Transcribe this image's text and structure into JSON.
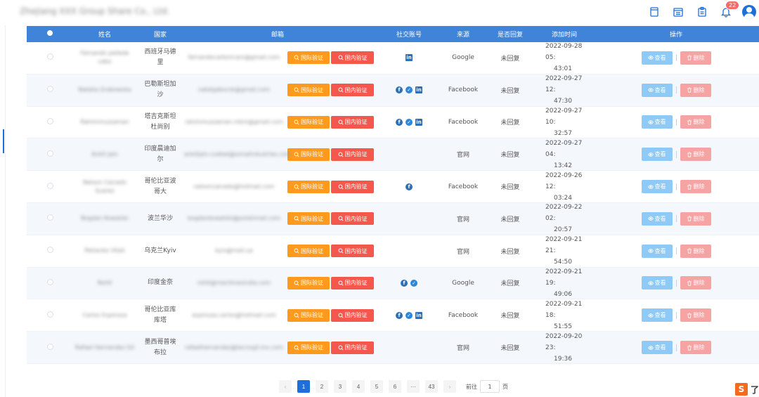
{
  "header": {
    "company": "Zhejiang XXX Group Share Co., Ltd.",
    "notification_count": "22",
    "icons": [
      "tablet-icon",
      "calendar-icon",
      "clipboard-icon",
      "bell-icon",
      "user-avatar"
    ]
  },
  "table": {
    "columns": [
      "姓名",
      "国家",
      "邮箱",
      "社交账号",
      "来源",
      "是否回复",
      "添加时间",
      "操作"
    ],
    "rows": [
      {
        "name": "Fernando paileda cabo",
        "country": "西班牙马德里",
        "email": "fernandocarboncaro@gmail.com",
        "social": [
          "linkedin"
        ],
        "source": "Google",
        "reply": "未回复",
        "time1": "2022-09-28 05:",
        "time2": "43:01"
      },
      {
        "name": "Natalia Grabowska",
        "country": "巴勒斯坦加沙",
        "email": "natalgaborsk@gmail.com",
        "social": [
          "facebook",
          "twitter",
          "linkedin"
        ],
        "source": "Facebook",
        "reply": "未回复",
        "time1": "2022-09-27 12:",
        "time2": "47:30"
      },
      {
        "name": "Rahimmuzzaman",
        "country": "塔吉克斯坦杜尚别",
        "email": "rahimmuzzaman.mkm@gmail.com",
        "social": [
          "facebook",
          "twitter",
          "linkedin"
        ],
        "source": "Facebook",
        "reply": "未回复",
        "time1": "2022-09-27 10:",
        "time2": "32:57"
      },
      {
        "name": "Ankit Jain",
        "country": "印度晨迪加尔",
        "email": "ankitjain.coated@sonalindustries.com",
        "social": [],
        "source": "官网",
        "reply": "未回复",
        "time1": "2022-09-27 04:",
        "time2": "13:42"
      },
      {
        "name": "Nelson Caicedo Suarez",
        "country": "哥伦比亚波哥大",
        "email": "nelsoncaicedo@hotmail.com",
        "social": [
          "facebook"
        ],
        "source": "Facebook",
        "reply": "未回复",
        "time1": "2022-09-26 12:",
        "time2": "03:24"
      },
      {
        "name": "Bogdan Kowalski",
        "country": "波兰华沙",
        "email": "bogdankowalski@polskimail.com",
        "social": [],
        "source": "官网",
        "reply": "未回复",
        "time1": "2022-09-22 02:",
        "time2": "20:57"
      },
      {
        "name": "Petrenko Vitali",
        "country": "乌克兰Kyiv",
        "email": "kyiv@mail.ua",
        "social": [],
        "source": "官网",
        "reply": "未回复",
        "time1": "2022-09-21 21:",
        "time2": "54:50"
      },
      {
        "name": "Rohit",
        "country": "印度金奈",
        "email": "rohit@machinesindia.com",
        "social": [
          "facebook",
          "twitter"
        ],
        "source": "Google",
        "reply": "未回复",
        "time1": "2022-09-21 19:",
        "time2": "49:06"
      },
      {
        "name": "Carlos Espinosa",
        "country": "哥伦比亚库库塔",
        "email": "espinoza.carlos@hotmail.com",
        "social": [
          "facebook",
          "twitter",
          "linkedin"
        ],
        "source": "Facebook",
        "reply": "未回复",
        "time1": "2022-09-21 18:",
        "time2": "51:55"
      },
      {
        "name": "Rafael Hernandez Gil",
        "country": "墨西哥普埃布拉",
        "email": "rafaelhernandez@tecnogil.mx.com",
        "social": [],
        "source": "官网",
        "reply": "未回复",
        "time1": "2022-09-20 23:",
        "time2": "19:36"
      }
    ],
    "buttons": {
      "intl": "国际验证",
      "domestic": "国内验证",
      "view": "查看",
      "delete": "删除"
    }
  },
  "pagination": {
    "pages": [
      "1",
      "2",
      "3",
      "4",
      "5",
      "6",
      "···",
      "43"
    ],
    "active": "1",
    "goto_label": "前往",
    "goto_value": "1",
    "page_unit": "页"
  },
  "corner": {
    "logo_letter": "S",
    "text": "了"
  },
  "colors": {
    "accent": "#1e6fd9",
    "header_bg": "#3f84d9",
    "intl_btn": "#ff9a1f",
    "dom_btn": "#f4584c",
    "view_btn": "#8fc9f5",
    "del_btn": "#f5a3a3"
  }
}
